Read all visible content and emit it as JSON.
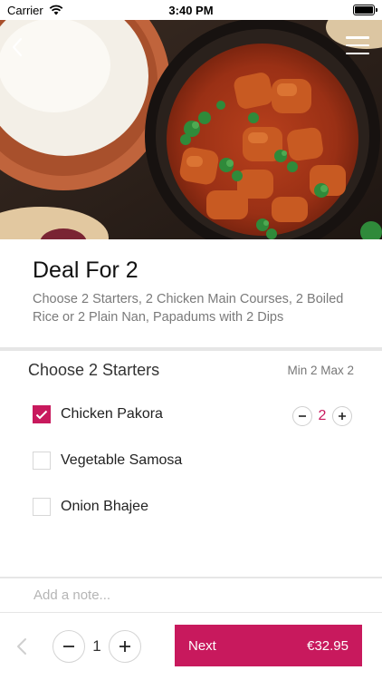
{
  "status_bar": {
    "carrier": "Carrier",
    "time": "3:40 PM"
  },
  "deal": {
    "title": "Deal For 2",
    "description": "Choose 2 Starters, 2 Chicken Main Courses, 2 Boiled Rice or 2 Plain Nan, Papadums with 2 Dips"
  },
  "section": {
    "title": "Choose 2 Starters",
    "limit": "Min 2 Max 2",
    "options": [
      {
        "label": "Chicken Pakora",
        "checked": true,
        "quantity": "2"
      },
      {
        "label": "Vegetable Samosa",
        "checked": false
      },
      {
        "label": "Onion Bhajee",
        "checked": false
      }
    ]
  },
  "note": {
    "placeholder": "Add a note..."
  },
  "footer": {
    "quantity": "1",
    "next_label": "Next",
    "price": "€32.95"
  },
  "colors": {
    "accent": "#c8195d",
    "divider": "#e6e6e6"
  }
}
